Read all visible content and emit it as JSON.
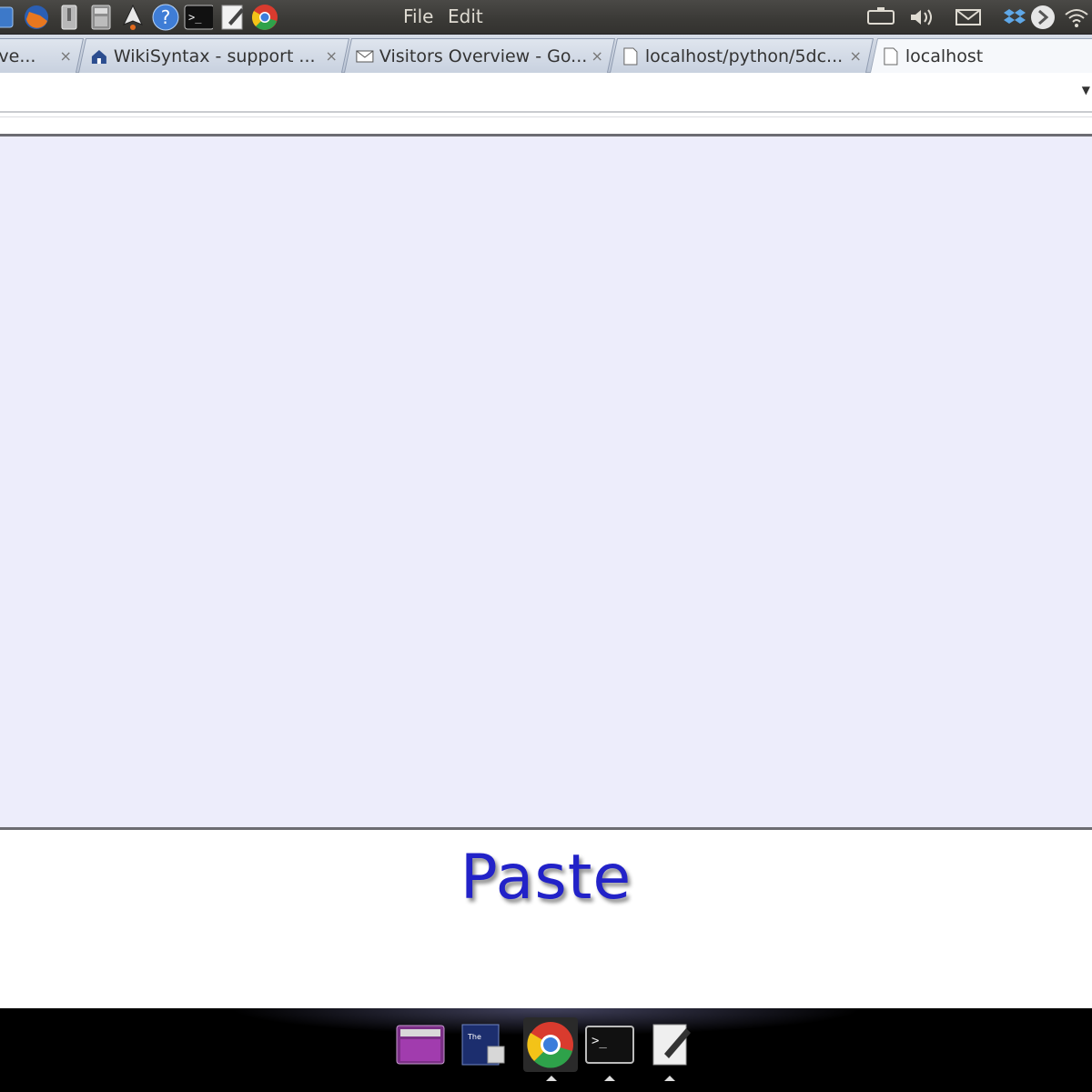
{
  "top_panel": {
    "menu": [
      {
        "label": "File"
      },
      {
        "label": "Edit"
      }
    ],
    "launchers": [
      "app-icon",
      "firefox-icon",
      "archive-icon",
      "calculator-icon",
      "inkscape-icon",
      "help-icon",
      "terminal-icon",
      "text-editor-icon",
      "chrome-icon"
    ],
    "tray": [
      "keyboard-icon",
      "volume-icon",
      "mail-icon",
      "dropbox-icon",
      "power-icon",
      "wifi-icon"
    ]
  },
  "tabs": [
    {
      "title": "erve...",
      "close": "×"
    },
    {
      "title": "WikiSyntax - support ...",
      "close": "×"
    },
    {
      "title": "Visitors Overview - Go...",
      "close": "×"
    },
    {
      "title": "localhost/python/5dc...",
      "close": "×"
    },
    {
      "title": "localhost",
      "close": ""
    }
  ],
  "page": {
    "paste_label": "Paste"
  },
  "dock": {
    "items": [
      "video-player-icon",
      "calendar-app-icon",
      "chrome-icon",
      "terminal-icon",
      "text-editor-icon"
    ]
  },
  "colors": {
    "paste_area_bg": "#ededfb",
    "paste_label": "#2222c8"
  }
}
